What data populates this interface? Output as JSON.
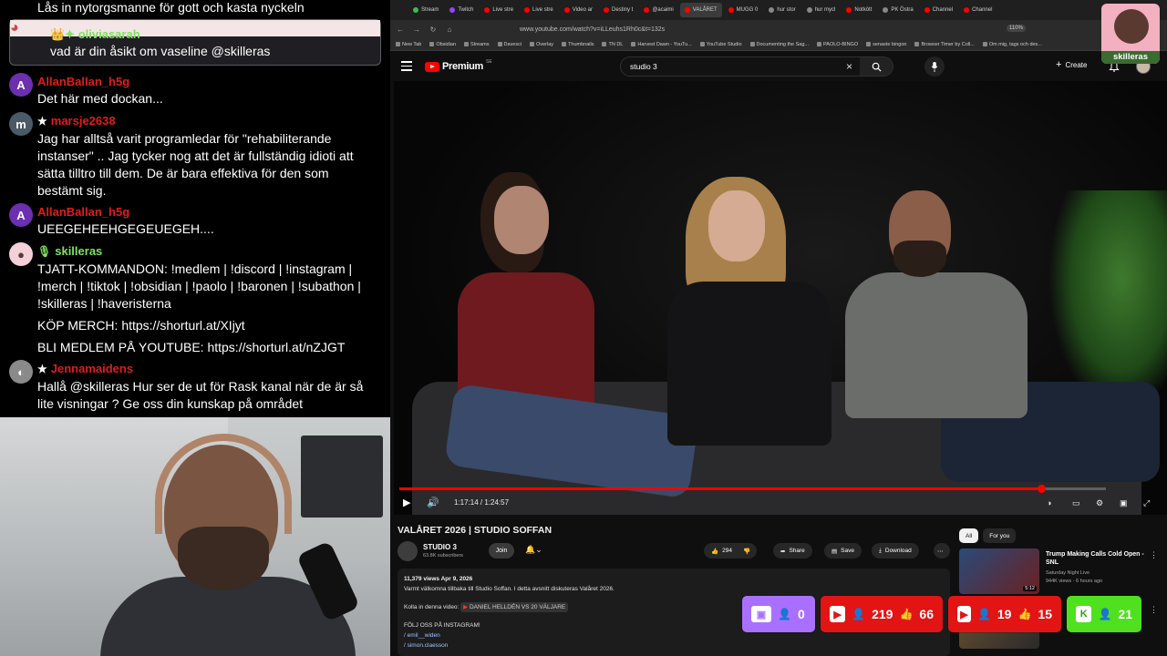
{
  "chat": {
    "top_line": "Lås in nytorgsmanne för gott och kasta nyckeln",
    "highlighted": {
      "username": "oliviasarah",
      "text": "vad är din åsikt om vaseline @skilleras"
    },
    "messages": [
      {
        "avatar": "A",
        "username": "AllanBallan_h5g",
        "lines": [
          "Det här med dockan..."
        ]
      },
      {
        "avatar": "m",
        "badge": "★",
        "username": "marsje2638",
        "lines": [
          "Jag har alltså varit programledar för \"rehabiliterande",
          "instanser\" .. Jag tycker nog att det är fullständig idioti att",
          "sätta tilltro till dem. De är bara effektiva för den som",
          "bestämt sig."
        ]
      },
      {
        "avatar": "A",
        "username": "AllanBallan_h5g",
        "lines": [
          "UEEGEHEEHGEGEUEGEH...."
        ]
      },
      {
        "avatar": "",
        "badge": "🎙",
        "username": "skilleras",
        "lines": [
          "TJATT-KOMMANDON: !medlem | !discord | !instagram |",
          "!merch | !tiktok | !obsidian | !paolo | !baronen | !subathon |",
          "!skilleras | !haveristerna"
        ],
        "extra": [
          "KÖP MERCH: https://shorturl.at/XIjyt",
          "BLI MEDLEM PÅ YOUTUBE: https://shorturl.at/nZJGT"
        ]
      },
      {
        "avatar": "",
        "badge": "★",
        "username": "Jennamaidens",
        "lines": [
          "Hallå @skilleras Hur ser de ut för Rask kanal när de är så",
          "lite visningar ? Ge oss din kunskap på området"
        ]
      }
    ]
  },
  "browser": {
    "tabs": [
      {
        "label": "Stream",
        "color": "#3cba54"
      },
      {
        "label": "Twitch",
        "color": "#9146ff"
      },
      {
        "label": "Live stre",
        "color": "#ff0000"
      },
      {
        "label": "Live stre",
        "color": "#ff0000"
      },
      {
        "label": "Video ar",
        "color": "#ff0000"
      },
      {
        "label": "Destiny t",
        "color": "#ff0000"
      },
      {
        "label": "@acaimi",
        "color": "#ff0000"
      },
      {
        "label": "VALÅRET",
        "color": "#ff0000",
        "active": true
      },
      {
        "label": "MUGG 0",
        "color": "#ff0000"
      },
      {
        "label": "hur stor",
        "color": "#888888"
      },
      {
        "label": "hur mycl",
        "color": "#888888"
      },
      {
        "label": "Notkött",
        "color": "#ff0000"
      },
      {
        "label": "PK Östra",
        "color": "#888888"
      },
      {
        "label": "Channel",
        "color": "#ff0000"
      },
      {
        "label": "Channel",
        "color": "#ff0000"
      }
    ],
    "url": "www.youtube.com/watch?v=iLLeuhs1Rh0c&t=132s",
    "zoom": "110%",
    "bookmarks": [
      "New Tab",
      "Obsidian",
      "Streams",
      "Davesci",
      "Overlay",
      "Thumbnails",
      "TN DL",
      "Harvest Dawn - YouTu...",
      "YouTube Studio",
      "Documenting the Sag...",
      "PAOLO-BINGO",
      "senaste bingon",
      "Browser Timer by Coll...",
      "Om mig, tags och des..."
    ]
  },
  "youtube": {
    "logo": "Premium",
    "logo_sup": "SE",
    "search_query": "studio 3",
    "create_label": "Create",
    "player": {
      "time": "1:17:14 / 1:24:57",
      "progress": 0.909
    },
    "title": "VALÅRET 2026 | STUDIO SOFFAN",
    "channel": {
      "name": "STUDIO 3",
      "subs": "63.8K subscribers",
      "join": "Join"
    },
    "actions": {
      "likes": "294",
      "share": "Share",
      "save": "Save",
      "download": "Download"
    },
    "description": {
      "meta": "11,379 views  Apr 9, 2026",
      "text": "Varmt välkomna tillbaka till Studio Soffan. I detta avsnitt diskuteras Valåret 2026.",
      "check_label": "Kolla in denna video:",
      "check_link": "DANIEL HELLDÉN VS 20 VÄLJARE",
      "follow": "FÖLJ OSS PÅ INSTAGRAM!",
      "ig1": "/ emil__widen",
      "ig2": "/ simon.claesson"
    },
    "sidebar": {
      "chips": [
        "All",
        "For you"
      ],
      "recs": [
        {
          "title": "Trump Making Calls Cold Open - SNL",
          "channel": "Saturday Night Live",
          "views": "944K views · 6 hours ago",
          "duration": "5:12"
        },
        {
          "title": "",
          "channel": "",
          "views": "",
          "duration": ""
        }
      ]
    }
  },
  "overlay": {
    "streamer_name": "skilleras",
    "twitch": {
      "viewers": "0"
    },
    "youtube1": {
      "viewers": "219",
      "likes": "66"
    },
    "youtube2": {
      "viewers": "19",
      "likes": "15"
    },
    "kick": {
      "viewers": "21"
    }
  },
  "colors": {
    "twitch": "#a970ff",
    "youtube": "#e31414",
    "kick": "#4fe11d",
    "accent_red": "#ff0000"
  }
}
